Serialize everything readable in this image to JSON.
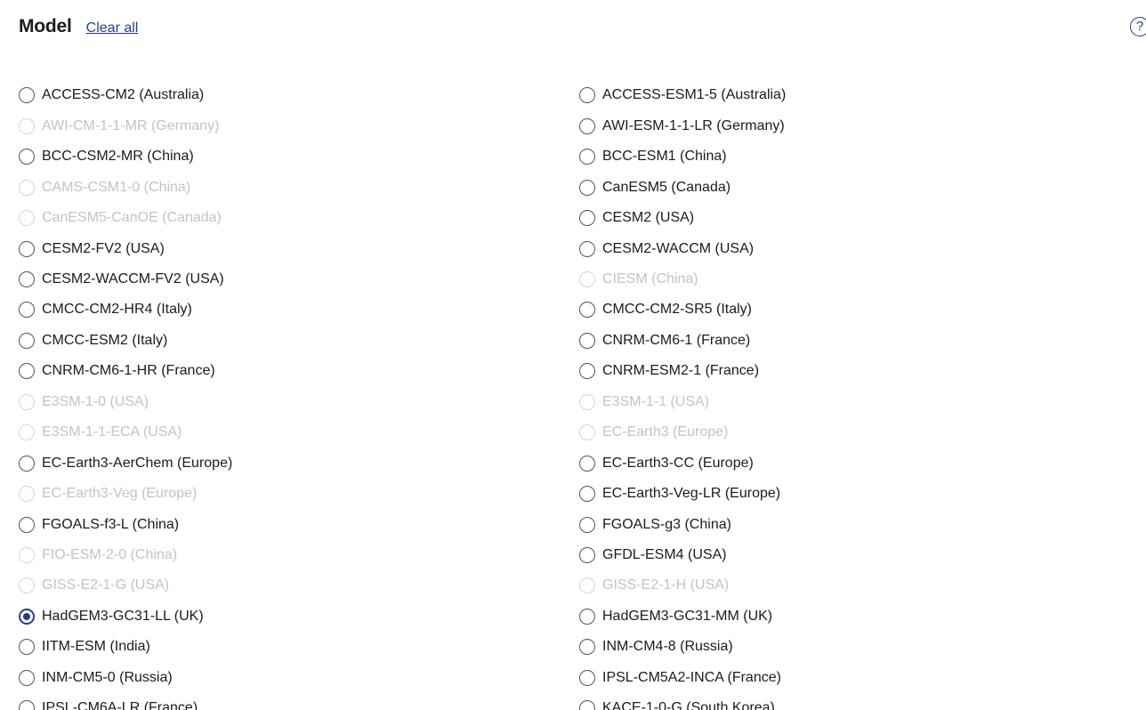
{
  "header": {
    "title": "Model",
    "clear_label": "Clear all",
    "help_glyph": "?"
  },
  "options": {
    "left": [
      {
        "label": "ACCESS-CM2 (Australia)",
        "state": "enabled"
      },
      {
        "label": "AWI-CM-1-1-MR (Germany)",
        "state": "disabled"
      },
      {
        "label": "BCC-CSM2-MR (China)",
        "state": "enabled"
      },
      {
        "label": "CAMS-CSM1-0 (China)",
        "state": "disabled"
      },
      {
        "label": "CanESM5-CanOE (Canada)",
        "state": "disabled"
      },
      {
        "label": "CESM2-FV2 (USA)",
        "state": "enabled"
      },
      {
        "label": "CESM2-WACCM-FV2 (USA)",
        "state": "enabled"
      },
      {
        "label": "CMCC-CM2-HR4 (Italy)",
        "state": "enabled"
      },
      {
        "label": "CMCC-ESM2 (Italy)",
        "state": "enabled"
      },
      {
        "label": "CNRM-CM6-1-HR (France)",
        "state": "enabled"
      },
      {
        "label": "E3SM-1-0 (USA)",
        "state": "disabled"
      },
      {
        "label": "E3SM-1-1-ECA (USA)",
        "state": "disabled"
      },
      {
        "label": "EC-Earth3-AerChem (Europe)",
        "state": "enabled"
      },
      {
        "label": "EC-Earth3-Veg (Europe)",
        "state": "disabled"
      },
      {
        "label": "FGOALS-f3-L (China)",
        "state": "enabled"
      },
      {
        "label": "FIO-ESM-2-0 (China)",
        "state": "disabled"
      },
      {
        "label": "GISS-E2-1-G (USA)",
        "state": "disabled"
      },
      {
        "label": "HadGEM3-GC31-LL (UK)",
        "state": "checked"
      },
      {
        "label": "IITM-ESM (India)",
        "state": "enabled"
      },
      {
        "label": "INM-CM5-0 (Russia)",
        "state": "enabled"
      },
      {
        "label": "IPSL-CM6A-LR (France)",
        "state": "enabled"
      }
    ],
    "right": [
      {
        "label": "ACCESS-ESM1-5 (Australia)",
        "state": "enabled"
      },
      {
        "label": "AWI-ESM-1-1-LR (Germany)",
        "state": "enabled"
      },
      {
        "label": "BCC-ESM1 (China)",
        "state": "enabled"
      },
      {
        "label": "CanESM5 (Canada)",
        "state": "enabled"
      },
      {
        "label": "CESM2 (USA)",
        "state": "enabled"
      },
      {
        "label": "CESM2-WACCM (USA)",
        "state": "enabled"
      },
      {
        "label": "CIESM (China)",
        "state": "disabled"
      },
      {
        "label": "CMCC-CM2-SR5 (Italy)",
        "state": "enabled"
      },
      {
        "label": "CNRM-CM6-1 (France)",
        "state": "enabled"
      },
      {
        "label": "CNRM-ESM2-1 (France)",
        "state": "enabled"
      },
      {
        "label": "E3SM-1-1 (USA)",
        "state": "disabled"
      },
      {
        "label": "EC-Earth3 (Europe)",
        "state": "disabled"
      },
      {
        "label": "EC-Earth3-CC (Europe)",
        "state": "enabled"
      },
      {
        "label": "EC-Earth3-Veg-LR (Europe)",
        "state": "enabled"
      },
      {
        "label": "FGOALS-g3 (China)",
        "state": "enabled"
      },
      {
        "label": "GFDL-ESM4 (USA)",
        "state": "enabled"
      },
      {
        "label": "GISS-E2-1-H (USA)",
        "state": "disabled"
      },
      {
        "label": "HadGEM3-GC31-MM (UK)",
        "state": "enabled"
      },
      {
        "label": "INM-CM4-8 (Russia)",
        "state": "enabled"
      },
      {
        "label": "IPSL-CM5A2-INCA (France)",
        "state": "enabled"
      },
      {
        "label": "KACE-1-0-G (South Korea)",
        "state": "enabled"
      }
    ]
  }
}
